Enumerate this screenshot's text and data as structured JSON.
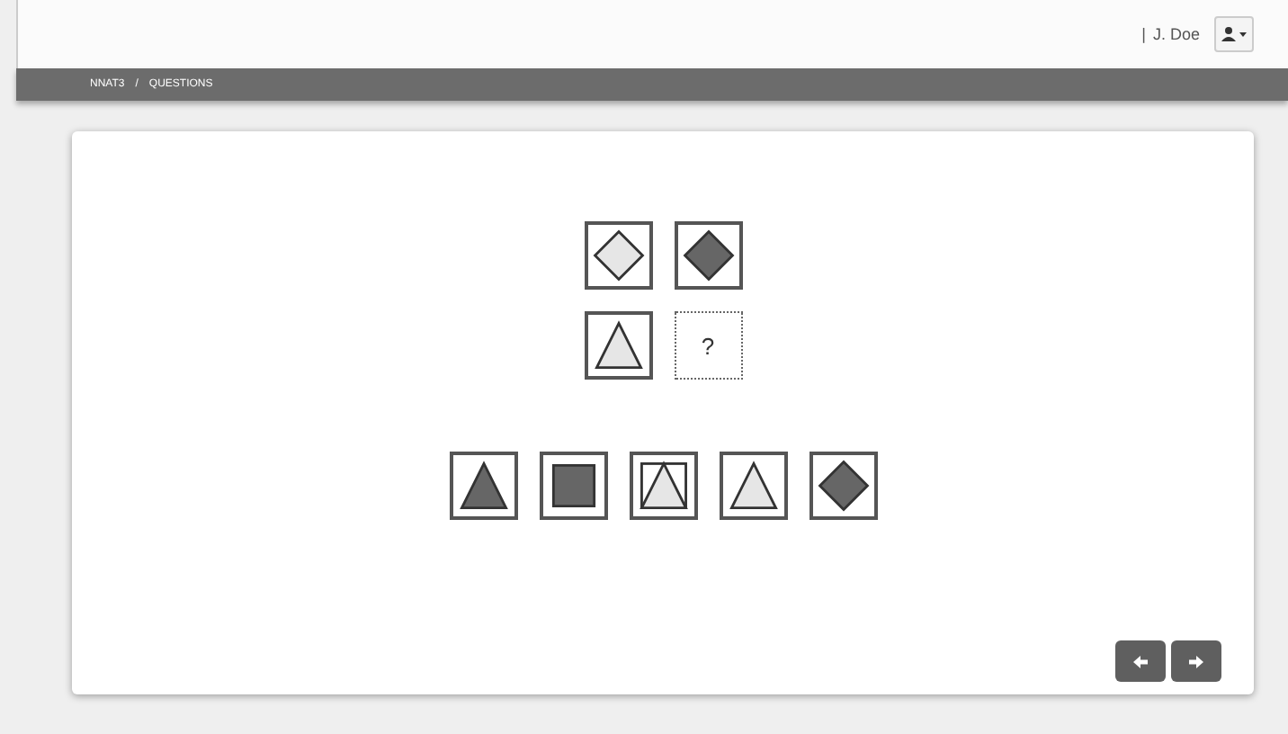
{
  "header": {
    "separator": "|",
    "user": "J. Doe"
  },
  "breadcrumb": [
    {
      "label": "NNAT3"
    },
    {
      "label": "QUESTIONS"
    }
  ],
  "breadcrumb_separator": "/",
  "matrix": [
    {
      "kind": "diamond-light"
    },
    {
      "kind": "diamond-dark"
    },
    {
      "kind": "triangle-light"
    },
    {
      "kind": "question",
      "text": "?"
    }
  ],
  "options": [
    {
      "kind": "triangle-dark"
    },
    {
      "kind": "square-dark"
    },
    {
      "kind": "square-triangle"
    },
    {
      "kind": "triangle-light"
    },
    {
      "kind": "diamond-dark"
    }
  ]
}
